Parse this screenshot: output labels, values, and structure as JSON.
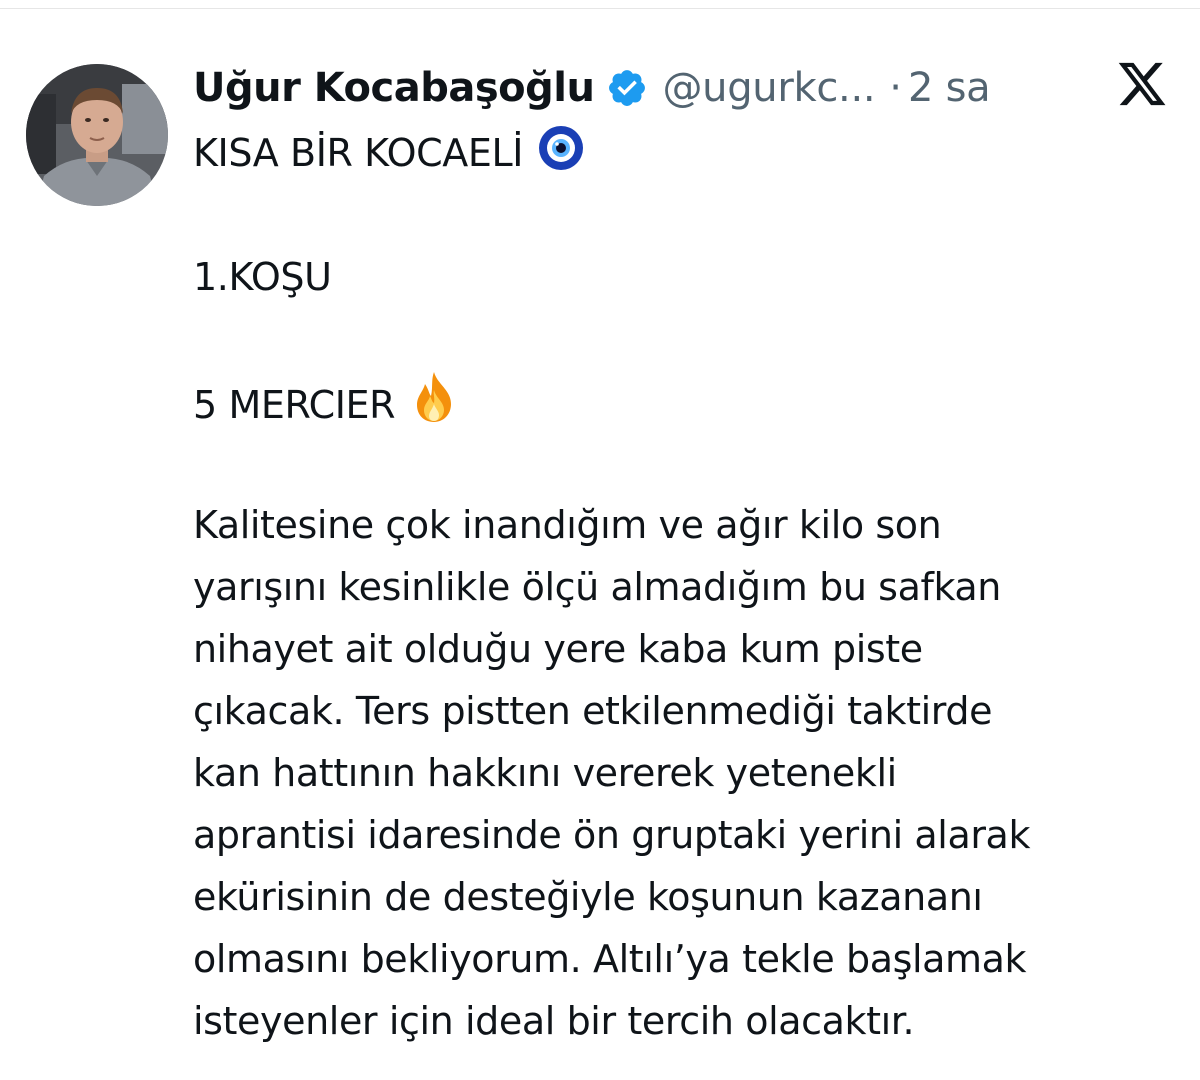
{
  "tweet": {
    "author_name": "Uğur Kocabaşoğlu",
    "handle": "@ugurkc...",
    "separator": "·",
    "time": "2 sa",
    "colors": {
      "text": "#0f1419",
      "secondary": "#536471",
      "verified_badge": "#1d9bf0"
    },
    "icons": {
      "verified": "verified-badge-icon",
      "platform_logo": "x-logo-icon",
      "nazar": "nazar-boncugu-icon",
      "fire": "fire-icon"
    },
    "lines": {
      "headline": "KISA BİR KOCAELİ",
      "race": "1.KOŞU",
      "pick": "5 MERCIER",
      "body": [
        "Kalitesine çok inandığım ve ağır kilo son",
        "yarışını kesinlikle ölçü almadığım bu safkan",
        "nihayet ait olduğu yere kaba kum piste",
        "çıkacak. Ters pistten etkilenmediği taktirde",
        "kan hattının hakkını vererek yetenekli",
        "aprantisi idaresinde ön gruptaki yerini alarak",
        "ekürisinin de desteğiyle koşunun kazananı",
        "olmasını bekliyorum. Altılı’ya tekle başlamak",
        "isteyenler için ideal bir tercih olacaktır."
      ]
    }
  }
}
